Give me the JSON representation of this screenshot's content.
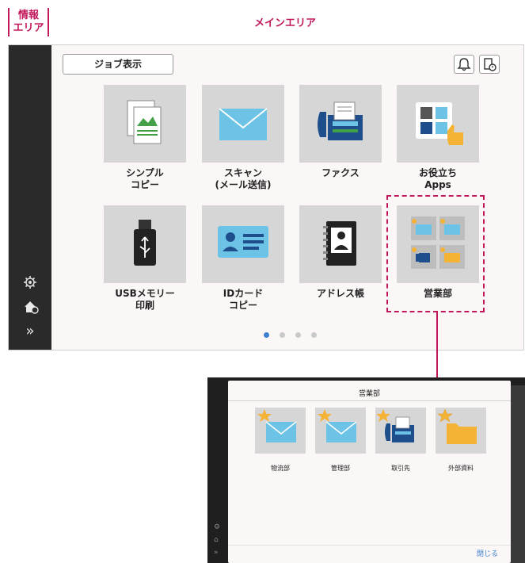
{
  "labels": {
    "info_area_line1": "情報",
    "info_area_line2": "エリア",
    "main_area": "メインエリア"
  },
  "screen": {
    "job_button": "ジョブ表示",
    "icons": [
      "settings-icon",
      "user-login-icon",
      "expand-icon",
      "bell-icon",
      "job-status-icon"
    ],
    "left_bar_expand": "»",
    "tiles": [
      {
        "label": "シンプル\nコピー",
        "icon": "simple-copy-icon"
      },
      {
        "label": "スキャン\n(メール送信)",
        "icon": "scan-mail-icon"
      },
      {
        "label": "ファクス",
        "icon": "fax-icon"
      },
      {
        "label": "お役立ち\nApps",
        "icon": "apps-icon"
      },
      {
        "label": "USBメモリー\n印刷",
        "icon": "usb-icon"
      },
      {
        "label": "IDカード\nコピー",
        "icon": "id-card-icon"
      },
      {
        "label": "アドレス帳",
        "icon": "address-book-icon"
      },
      {
        "label": "営業部",
        "icon": "folder-group-icon"
      }
    ],
    "page_dots": {
      "count": 4,
      "active": 0
    }
  },
  "popup": {
    "title": "営業部",
    "tiles": [
      {
        "label": "物流部",
        "icon": "starred-mail-icon"
      },
      {
        "label": "管理部",
        "icon": "starred-mail-icon"
      },
      {
        "label": "取引先",
        "icon": "starred-fax-icon"
      },
      {
        "label": "外部資料",
        "icon": "starred-folder-icon"
      }
    ],
    "close_label": "閉じる"
  },
  "colors": {
    "accent": "#c2185b",
    "mail": "#6cc3e6",
    "fax": "#1f4e8c",
    "folder": "#f5b335",
    "green": "#43a047",
    "close": "#3a7fd0"
  }
}
